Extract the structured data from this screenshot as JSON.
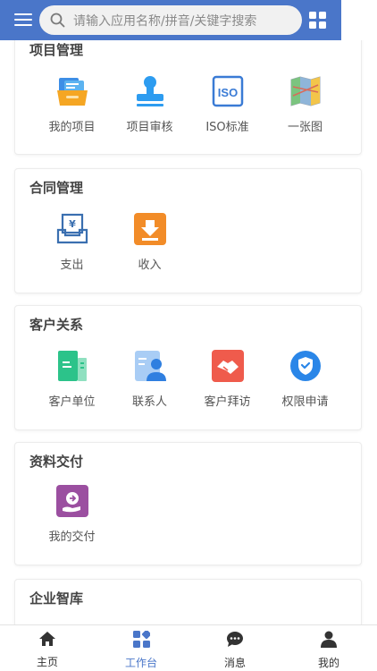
{
  "search": {
    "placeholder": "请输入应用名称/拼音/关键字搜索"
  },
  "sections": [
    {
      "title": "项目管理",
      "apps": [
        {
          "label": "我的项目",
          "icon": "folder-icon"
        },
        {
          "label": "项目审核",
          "icon": "stamp-icon"
        },
        {
          "label": "ISO标准",
          "icon": "iso-icon"
        },
        {
          "label": "一张图",
          "icon": "map-icon"
        }
      ]
    },
    {
      "title": "合同管理",
      "apps": [
        {
          "label": "支出",
          "icon": "expense-icon"
        },
        {
          "label": "收入",
          "icon": "income-icon"
        }
      ]
    },
    {
      "title": "客户关系",
      "apps": [
        {
          "label": "客户单位",
          "icon": "company-icon"
        },
        {
          "label": "联系人",
          "icon": "contact-icon"
        },
        {
          "label": "客户拜访",
          "icon": "handshake-icon"
        },
        {
          "label": "权限申请",
          "icon": "shield-check-icon"
        }
      ]
    },
    {
      "title": "资料交付",
      "apps": [
        {
          "label": "我的交付",
          "icon": "delivery-icon"
        }
      ]
    },
    {
      "title": "企业智库",
      "apps": []
    }
  ],
  "tabbar": [
    {
      "label": "主页",
      "icon": "home-icon",
      "active": false
    },
    {
      "label": "工作台",
      "icon": "workbench-icon",
      "active": true
    },
    {
      "label": "消息",
      "icon": "message-icon",
      "active": false
    },
    {
      "label": "我的",
      "icon": "user-icon",
      "active": false
    }
  ],
  "colors": {
    "header": "#4a76c9",
    "active_tab": "#4a76c9"
  }
}
